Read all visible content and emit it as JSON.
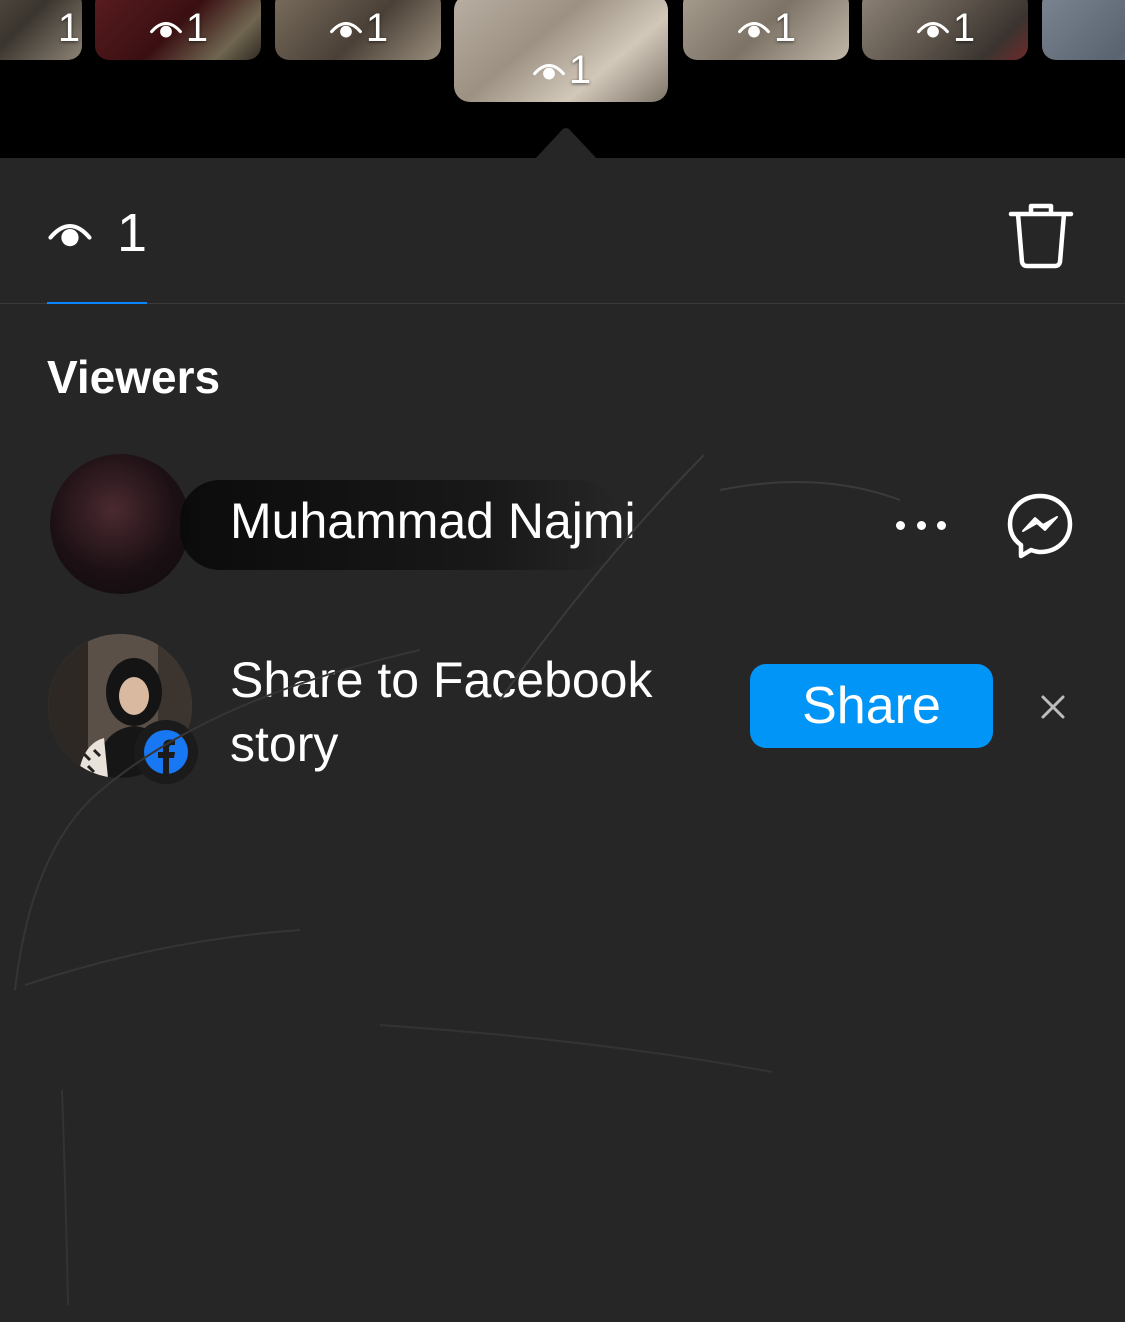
{
  "story_strip": {
    "thumbnails": [
      {
        "count": "1",
        "active": false
      },
      {
        "count": "1",
        "active": false
      },
      {
        "count": "1",
        "active": false
      },
      {
        "count": "1",
        "active": true
      },
      {
        "count": "1",
        "active": false
      },
      {
        "count": "1",
        "active": false
      },
      {
        "count": "",
        "active": false
      }
    ]
  },
  "stats": {
    "view_count": "1"
  },
  "viewers": {
    "title": "Viewers",
    "items": [
      {
        "name": "Muhammad Najmi"
      }
    ]
  },
  "share_card": {
    "text": "Share to Facebook story",
    "button_label": "Share"
  },
  "colors": {
    "background": "#262626",
    "strip": "#000000",
    "accent": "#0095f6",
    "tab_underline": "#0a84ff"
  }
}
